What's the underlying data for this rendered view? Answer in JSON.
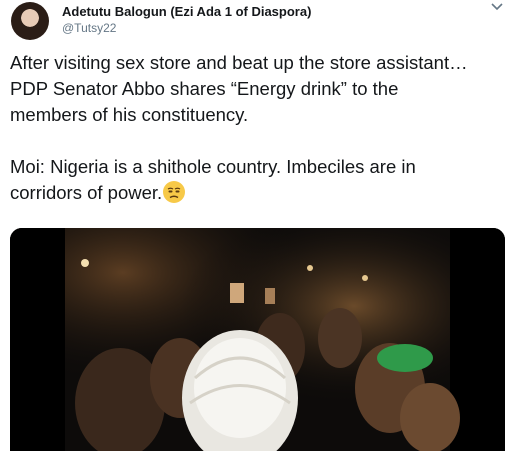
{
  "tweet": {
    "author_name": "Adetutu Balogun (Ezi Ada 1 of Diaspora)",
    "author_handle": "@Tutsy22",
    "text": "After visiting sex store and beat up the store assistant…\nPDP Senator Abbo shares “Energy drink” to the\nmembers of his constituency.\n\nMoi: Nigeria is a shithole country. Imbeciles are in\ncorridors of power.",
    "emoji_icon": "unamused-face-icon",
    "caret_icon": "chevron-down-icon",
    "media_type": "video-still"
  },
  "colors": {
    "text": "#14171a",
    "secondary": "#657786",
    "emoji": "#f7c948"
  }
}
